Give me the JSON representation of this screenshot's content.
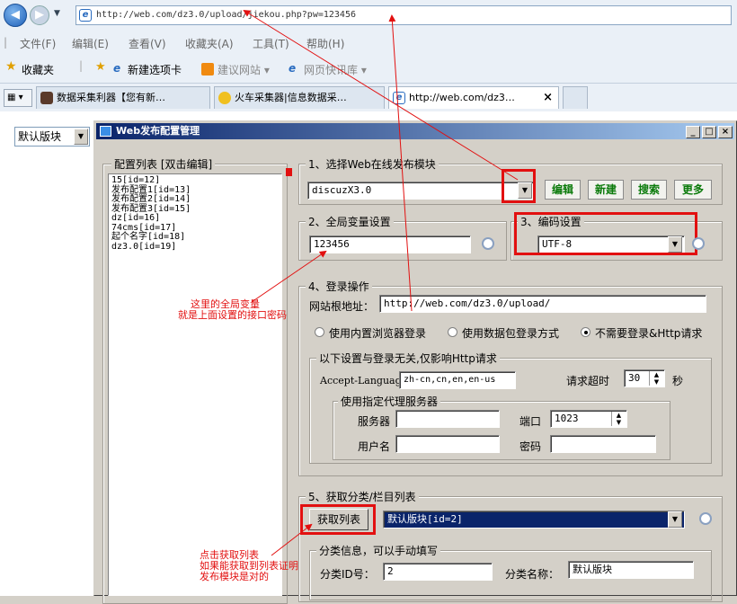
{
  "browser": {
    "url": "http://web.com/dz3.0/upload/jiekou.php?pw=123456",
    "menu": [
      "文件(F)",
      "编辑(E)",
      "查看(V)",
      "收藏夹(A)",
      "工具(T)",
      "帮助(H)"
    ],
    "favorites_label": "收藏夹",
    "fav_items": [
      "新建选项卡",
      "建议网站 ▾",
      "网页快讯库 ▾"
    ],
    "tabs": [
      "数据采集利器【您有新…",
      "火车采集器|信息数据采…",
      "http://web.com/dz3…"
    ],
    "tab_close": "×"
  },
  "page": {
    "select_value": "默认版块"
  },
  "dialog": {
    "title": "Web发布配置管理",
    "config_list": {
      "legend": "配置列表 [双击编辑]",
      "items": [
        "15[id=12]",
        "发布配置1[id=13]",
        "发布配置2[id=14]",
        "发布配置3[id=15]",
        "dz[id=16]",
        "74cms[id=17]",
        "起个名字[id=18]",
        "dz3.0[id=19]"
      ]
    },
    "section1": {
      "legend": "1、选择Web在线发布模块",
      "module_value": "discuzX3.0",
      "buttons": [
        "编辑",
        "新建",
        "搜索",
        "更多"
      ]
    },
    "section2": {
      "legend": "2、全局变量设置",
      "value": "123456"
    },
    "section3": {
      "legend": "3、编码设置",
      "value": "UTF-8"
    },
    "section4": {
      "legend": "4、登录操作",
      "root_label": "网站根地址：",
      "root_value": "http://web.com/dz3.0/upload/",
      "radio1": "使用内置浏览器登录",
      "radio2": "使用数据包登录方式",
      "radio3": "不需要登录&Http请求",
      "http_legend": "以下设置与登录无关,仅影响Http请求",
      "accept_label": "Accept-Language",
      "accept_value": "zh-cn,cn,en,en-us",
      "timeout_label": "请求超时",
      "timeout_value": "30",
      "timeout_unit": "秒",
      "proxy_legend": "使用指定代理服务器",
      "server_label": "服务器",
      "port_label": "端口",
      "port_value": "1023",
      "user_label": "用户名",
      "pass_label": "密码"
    },
    "section5": {
      "legend": "5、获取分类/栏目列表",
      "fetch_button": "获取列表",
      "category_value": "默认版块[id=2]",
      "info_legend": "分类信息，可以手动填写",
      "id_label": "分类ID号：",
      "id_value": "2",
      "name_label": "分类名称：",
      "name_value": "默认版块"
    }
  },
  "annotations": {
    "note1": [
      "这里的全局变量",
      "就是上面设置的接口密码"
    ],
    "note2": [
      "点击获取列表",
      "如果能获取到列表证明",
      "发布模块是对的"
    ]
  },
  "colors": {
    "annotation": "#e21010",
    "title_start": "#0a246a",
    "green_btn": "#0a7a0a"
  }
}
